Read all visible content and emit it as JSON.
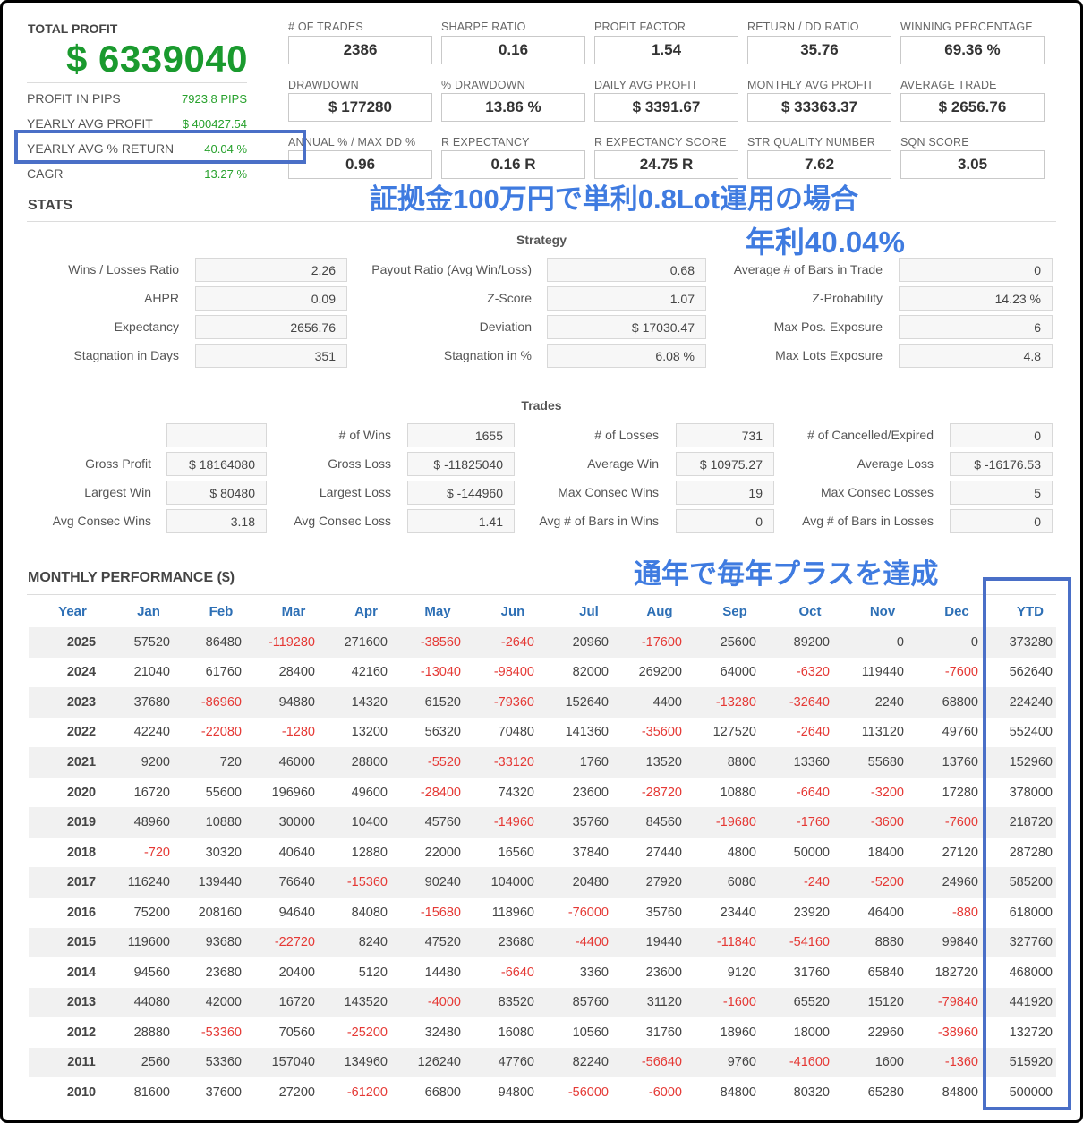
{
  "summary": {
    "total_profit_label": "TOTAL PROFIT",
    "total_profit_value": "$ 6339040",
    "rows": [
      {
        "label": "PROFIT IN PIPS",
        "value": "7923.8 PIPS"
      },
      {
        "label": "YEARLY AVG PROFIT",
        "value": "$ 400427.54"
      },
      {
        "label": "YEARLY AVG % RETURN",
        "value": "40.04 %"
      },
      {
        "label": "CAGR",
        "value": "13.27 %"
      }
    ]
  },
  "kpis": [
    {
      "label": "# OF TRADES",
      "value": "2386"
    },
    {
      "label": "SHARPE RATIO",
      "value": "0.16"
    },
    {
      "label": "PROFIT FACTOR",
      "value": "1.54"
    },
    {
      "label": "RETURN / DD RATIO",
      "value": "35.76"
    },
    {
      "label": "WINNING PERCENTAGE",
      "value": "69.36 %"
    },
    {
      "label": "DRAWDOWN",
      "value": "$ 177280"
    },
    {
      "label": "% DRAWDOWN",
      "value": "13.86 %"
    },
    {
      "label": "DAILY AVG PROFIT",
      "value": "$ 3391.67"
    },
    {
      "label": "MONTHLY AVG PROFIT",
      "value": "$ 33363.37"
    },
    {
      "label": "AVERAGE TRADE",
      "value": "$ 2656.76"
    },
    {
      "label": "ANNUAL % / MAX DD %",
      "value": "0.96"
    },
    {
      "label": "R EXPECTANCY",
      "value": "0.16 R"
    },
    {
      "label": "R EXPECTANCY SCORE",
      "value": "24.75 R"
    },
    {
      "label": "STR QUALITY NUMBER",
      "value": "7.62"
    },
    {
      "label": "SQN SCORE",
      "value": "3.05"
    }
  ],
  "stats_title": "STATS",
  "strategy": {
    "title": "Strategy",
    "rows": [
      [
        {
          "label": "Wins / Losses Ratio",
          "value": "2.26"
        },
        {
          "label": "Payout Ratio (Avg Win/Loss)",
          "value": "0.68"
        },
        {
          "label": "Average # of Bars in Trade",
          "value": "0"
        }
      ],
      [
        {
          "label": "AHPR",
          "value": "0.09"
        },
        {
          "label": "Z-Score",
          "value": "1.07"
        },
        {
          "label": "Z-Probability",
          "value": "14.23 %"
        }
      ],
      [
        {
          "label": "Expectancy",
          "value": "2656.76"
        },
        {
          "label": "Deviation",
          "value": "$ 17030.47"
        },
        {
          "label": "Max Pos. Exposure",
          "value": "6"
        }
      ],
      [
        {
          "label": "Stagnation in Days",
          "value": "351"
        },
        {
          "label": "Stagnation in %",
          "value": "6.08 %"
        },
        {
          "label": "Max Lots Exposure",
          "value": "4.8"
        }
      ]
    ]
  },
  "trades": {
    "title": "Trades",
    "rows": [
      [
        {
          "label": "",
          "value": ""
        },
        {
          "label": "# of Wins",
          "value": "1655"
        },
        {
          "label": "# of Losses",
          "value": "731"
        },
        {
          "label": "# of Cancelled/Expired",
          "value": "0"
        }
      ],
      [
        {
          "label": "Gross Profit",
          "value": "$ 18164080"
        },
        {
          "label": "Gross Loss",
          "value": "$ -11825040"
        },
        {
          "label": "Average Win",
          "value": "$ 10975.27"
        },
        {
          "label": "Average Loss",
          "value": "$ -16176.53"
        }
      ],
      [
        {
          "label": "Largest Win",
          "value": "$ 80480"
        },
        {
          "label": "Largest Loss",
          "value": "$ -144960"
        },
        {
          "label": "Max Consec Wins",
          "value": "19"
        },
        {
          "label": "Max Consec Losses",
          "value": "5"
        }
      ],
      [
        {
          "label": "Avg Consec Wins",
          "value": "3.18"
        },
        {
          "label": "Avg Consec Loss",
          "value": "1.41"
        },
        {
          "label": "Avg # of Bars in Wins",
          "value": "0"
        },
        {
          "label": "Avg # of Bars in Losses",
          "value": "0"
        }
      ]
    ]
  },
  "monthly": {
    "title": "MONTHLY PERFORMANCE ($)",
    "headers": [
      "Year",
      "Jan",
      "Feb",
      "Mar",
      "Apr",
      "May",
      "Jun",
      "Jul",
      "Aug",
      "Sep",
      "Oct",
      "Nov",
      "Dec",
      "YTD"
    ],
    "rows": [
      [
        "2025",
        "57520",
        "86480",
        "-119280",
        "271600",
        "-38560",
        "-2640",
        "20960",
        "-17600",
        "25600",
        "89200",
        "0",
        "0",
        "373280"
      ],
      [
        "2024",
        "21040",
        "61760",
        "28400",
        "42160",
        "-13040",
        "-98400",
        "82000",
        "269200",
        "64000",
        "-6320",
        "119440",
        "-7600",
        "562640"
      ],
      [
        "2023",
        "37680",
        "-86960",
        "94880",
        "14320",
        "61520",
        "-79360",
        "152640",
        "4400",
        "-13280",
        "-32640",
        "2240",
        "68800",
        "224240"
      ],
      [
        "2022",
        "42240",
        "-22080",
        "-1280",
        "13200",
        "56320",
        "70480",
        "141360",
        "-35600",
        "127520",
        "-2640",
        "113120",
        "49760",
        "552400"
      ],
      [
        "2021",
        "9200",
        "720",
        "46000",
        "28800",
        "-5520",
        "-33120",
        "1760",
        "13520",
        "8800",
        "13360",
        "55680",
        "13760",
        "152960"
      ],
      [
        "2020",
        "16720",
        "55600",
        "196960",
        "49600",
        "-28400",
        "74320",
        "23600",
        "-28720",
        "10880",
        "-6640",
        "-3200",
        "17280",
        "378000"
      ],
      [
        "2019",
        "48960",
        "10880",
        "30000",
        "10400",
        "45760",
        "-14960",
        "35760",
        "84560",
        "-19680",
        "-1760",
        "-3600",
        "-7600",
        "218720"
      ],
      [
        "2018",
        "-720",
        "30320",
        "40640",
        "12880",
        "22000",
        "16560",
        "37840",
        "27440",
        "4800",
        "50000",
        "18400",
        "27120",
        "287280"
      ],
      [
        "2017",
        "116240",
        "139440",
        "76640",
        "-15360",
        "90240",
        "104000",
        "20480",
        "27920",
        "6080",
        "-240",
        "-5200",
        "24960",
        "585200"
      ],
      [
        "2016",
        "75200",
        "208160",
        "94640",
        "84080",
        "-15680",
        "118960",
        "-76000",
        "35760",
        "23440",
        "23920",
        "46400",
        "-880",
        "618000"
      ],
      [
        "2015",
        "119600",
        "93680",
        "-22720",
        "8240",
        "47520",
        "23680",
        "-4400",
        "19440",
        "-11840",
        "-54160",
        "8880",
        "99840",
        "327760"
      ],
      [
        "2014",
        "94560",
        "23680",
        "20400",
        "5120",
        "14480",
        "-6640",
        "3360",
        "23600",
        "9120",
        "31760",
        "65840",
        "182720",
        "468000"
      ],
      [
        "2013",
        "44080",
        "42000",
        "16720",
        "143520",
        "-4000",
        "83520",
        "85760",
        "31120",
        "-1600",
        "65520",
        "15120",
        "-79840",
        "441920"
      ],
      [
        "2012",
        "28880",
        "-53360",
        "70560",
        "-25200",
        "32480",
        "16080",
        "10560",
        "31760",
        "18960",
        "18000",
        "22960",
        "-38960",
        "132720"
      ],
      [
        "2011",
        "2560",
        "53360",
        "157040",
        "134960",
        "126240",
        "47760",
        "82240",
        "-56640",
        "9760",
        "-41600",
        "1600",
        "-1360",
        "515920"
      ],
      [
        "2010",
        "81600",
        "37600",
        "27200",
        "-61200",
        "66800",
        "94800",
        "-56000",
        "-6000",
        "84800",
        "80320",
        "65280",
        "84800",
        "500000"
      ]
    ]
  },
  "annotations": {
    "line1": "証拠金100万円で単利0.8Lot運用の場合",
    "line2": "年利40.04%",
    "line3": "通年で毎年プラスを達成"
  },
  "colors": {
    "profit_green": "#1a9a2e",
    "negative_red": "#e53935",
    "header_blue": "#2d6fb5",
    "highlight_frame": "#4a6fc7",
    "annotation_blue": "#3f7be0"
  }
}
